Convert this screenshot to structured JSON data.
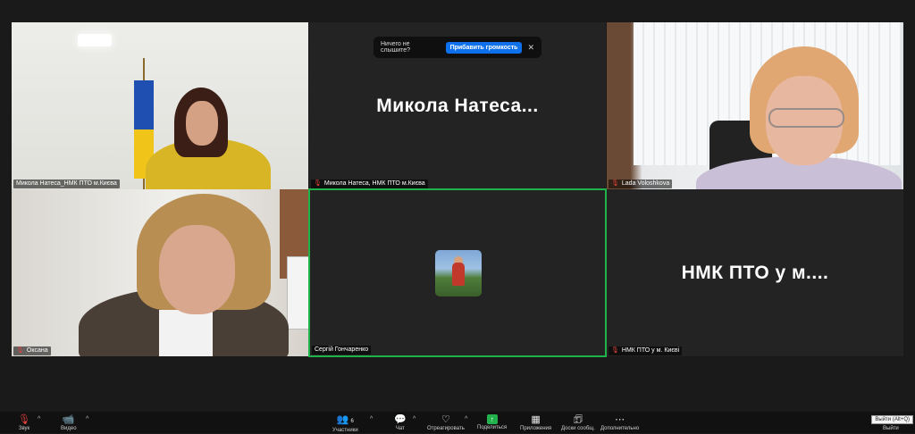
{
  "notification": {
    "text": "Ничего не слышите?",
    "button": "Прибавить громкость"
  },
  "tiles": [
    {
      "label": "Микола Натеса_НМК ПТО м.Києва"
    },
    {
      "label": "Микола Натеса, НМК ПТО м.Києва",
      "big_name": "Микола  Натеса..."
    },
    {
      "label": "Lada Voloshkova"
    },
    {
      "label": "Оксана"
    },
    {
      "label": "Сергій Гончаренко"
    },
    {
      "label": "НМК ПТО у м. Києві",
      "big_name": "НМК ПТО у м...."
    }
  ],
  "toolbar": {
    "mic_label": "Звук",
    "video_label": "Видео",
    "participants_count": "6",
    "participants_label": "Участники",
    "chat_label": "Чат",
    "reactions_label": "Отреагировать",
    "share_label": "Поделиться",
    "apps_label": "Приложения",
    "whiteboard_label": "Доски сообщ.",
    "more_label": "Дополнительно",
    "leave_label": "Выйти"
  },
  "tooltip": "Выйти (Alt+Q)",
  "colors": {
    "active_border": "#21b34b",
    "notify_button": "#0e71eb",
    "muted_mic": "#e0423b",
    "share_green": "#22b14c"
  }
}
